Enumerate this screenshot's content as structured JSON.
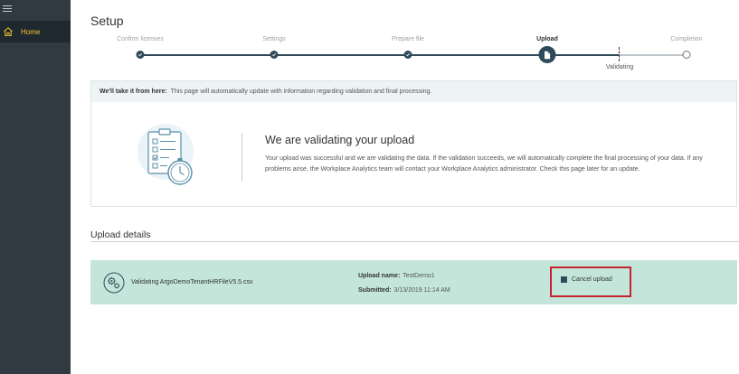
{
  "sidebar": {
    "menu_icon": "hamburger-icon",
    "items": [
      {
        "icon": "home-icon",
        "label": "Home",
        "active": true
      }
    ],
    "accent": "#f4c430"
  },
  "page": {
    "title": "Setup"
  },
  "stepper": {
    "steps": [
      {
        "label": "Confirm licenses",
        "state": "complete"
      },
      {
        "label": "Settings",
        "state": "complete"
      },
      {
        "label": "Prepare file",
        "state": "complete"
      },
      {
        "label": "Upload",
        "state": "active"
      },
      {
        "label": "Completion",
        "state": "pending"
      }
    ],
    "substep_label": "Validating",
    "color": "#2f4a58"
  },
  "info": {
    "header_bold": "We'll take it from here:",
    "header_text": "This page will automatically update with information regarding validation and final processing.",
    "title": "We are validating your upload",
    "body": "Your upload was successful and we are validating the data. If the validation succeeds, we will automatically complete the final processing of your data. If any problems arise, the Workplace Analytics team will contact your Workplace Analytics administrator. Check this page later for an update."
  },
  "upload_details": {
    "section_title": "Upload details",
    "status_text": "Validating ArgoDemoTenantHRFileV5.5.csv",
    "name_label": "Upload name:",
    "name_value": "TestDemo1",
    "submitted_label": "Submitted:",
    "submitted_value": "3/13/2019 11:14 AM",
    "cancel_label": "Cancel upload",
    "card_color": "#c4e6da",
    "highlight_color": "#c7232d"
  }
}
